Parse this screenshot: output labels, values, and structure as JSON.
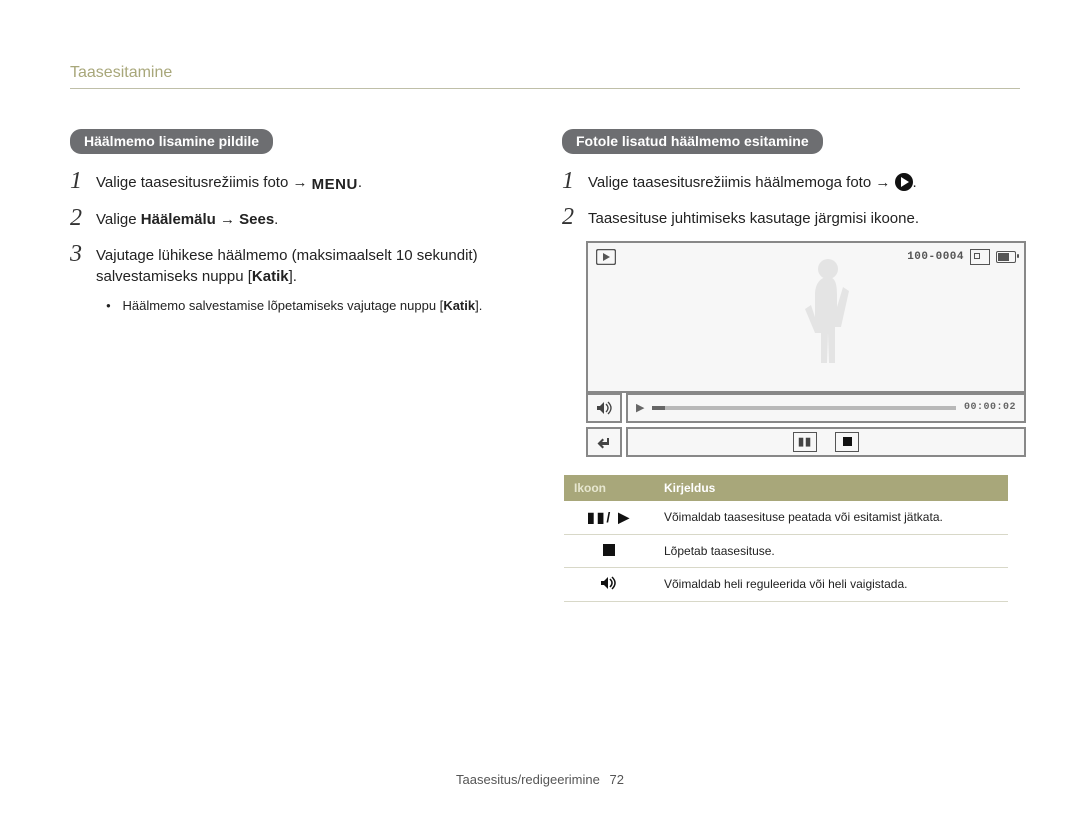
{
  "header": {
    "title": "Taasesitamine"
  },
  "left": {
    "pill": "Häälmemo lisamine pildile",
    "steps": [
      {
        "num": "1",
        "pre": "Valige taasesitusrežiimis foto → ",
        "icon_text": "MENU",
        "post": "."
      },
      {
        "num": "2",
        "pre": "Valige ",
        "bold": "Häälemälu → Sees",
        "post": "."
      },
      {
        "num": "3",
        "pre": "Vajutage lühikese häälmemo (maksimaalselt 10 sekundit) salvestamiseks nuppu [",
        "bold": "Katik",
        "post": "]."
      }
    ],
    "sub_bullet": {
      "pre": "Häälmemo salvestamise lõpetamiseks vajutage nuppu [",
      "bold": "Katik",
      "post": "]."
    }
  },
  "right": {
    "pill": "Fotole lisatud häälmemo esitamine",
    "steps": [
      {
        "num": "1",
        "pre": "Valige taasesitusrežiimis häälmemoga foto → ",
        "post": "."
      },
      {
        "num": "2",
        "pre": "Taasesituse juhtimiseks kasutage järgmisi ikoone."
      }
    ],
    "lcd": {
      "counter": "100-0004",
      "time": "00:00:02"
    },
    "table": {
      "head_icon": "Ikoon",
      "head_desc": "Kirjeldus",
      "rows": [
        {
          "icon_label": "pause-play",
          "desc": "Võimaldab taasesituse peatada või esitamist jätkata."
        },
        {
          "icon_label": "stop",
          "desc": "Lõpetab taasesituse."
        },
        {
          "icon_label": "volume",
          "desc": "Võimaldab heli reguleerida või heli vaigistada."
        }
      ]
    }
  },
  "footer": {
    "section": "Taasesitus/redigeerimine",
    "page": "72"
  }
}
